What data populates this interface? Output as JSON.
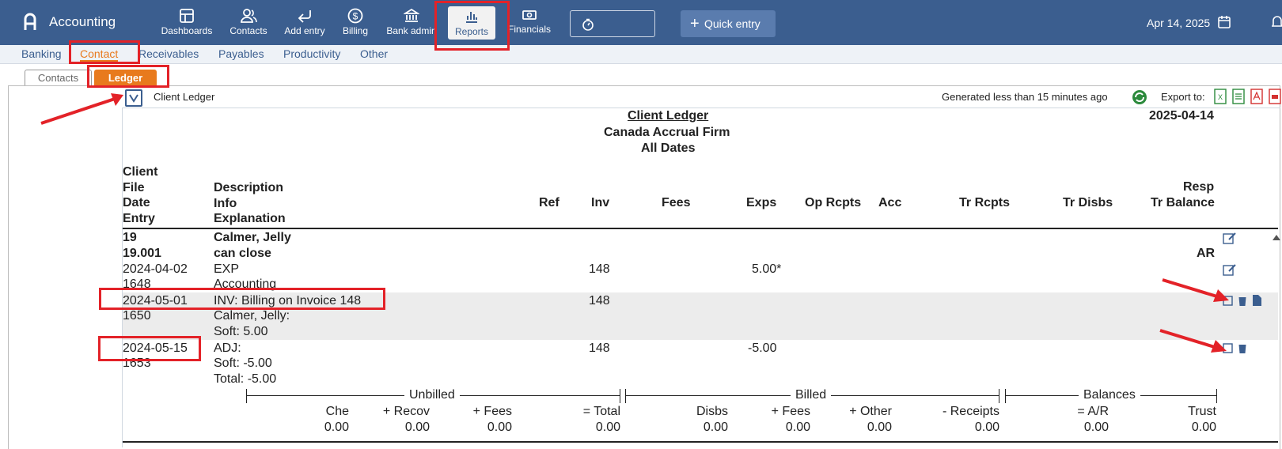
{
  "app": {
    "title": "Accounting"
  },
  "nav": [
    {
      "label": "Dashboards"
    },
    {
      "label": "Contacts"
    },
    {
      "label": "Add entry"
    },
    {
      "label": "Billing"
    },
    {
      "label": "Bank admin"
    },
    {
      "label": "Reports"
    },
    {
      "label": "Financials"
    }
  ],
  "quick_entry": "Quick entry",
  "date": "Apr 14, 2025",
  "subnav": [
    "Banking",
    "Contact",
    "Receivables",
    "Payables",
    "Productivity",
    "Other"
  ],
  "tabs": [
    "Contacts",
    "Ledger"
  ],
  "report_bar": {
    "name": "Client Ledger",
    "generated": "Generated less than 15 minutes ago",
    "export_label": "Export to:"
  },
  "report": {
    "title": "Client Ledger",
    "firm": "Canada Accrual Firm",
    "range": "All Dates",
    "date": "2025-04-14",
    "headers": {
      "client": "Client",
      "file": "File",
      "date": "Date",
      "entry": "Entry",
      "description": "Description",
      "info": "Info",
      "explanation": "Explanation",
      "ref": "Ref",
      "inv": "Inv",
      "fees": "Fees",
      "exps": "Exps",
      "op_rcpts": "Op Rcpts",
      "acc": "Acc",
      "tr_rcpts": "Tr Rcpts",
      "tr_disbs": "Tr Disbs",
      "resp": "Resp",
      "tr_balance": "Tr Balance"
    },
    "client_no": "19",
    "client_name": "Calmer, Jelly",
    "file_no": "19.001",
    "file_desc": "can close",
    "resp": "AR",
    "rows": [
      {
        "date": "2024-04-02",
        "entry": "1648",
        "desc": "EXP",
        "info": "Accounting",
        "inv": "148",
        "exps": "5.00*"
      },
      {
        "date": "2024-05-01",
        "entry": "1650",
        "desc": "INV: Billing on Invoice 148",
        "info": "Calmer, Jelly:",
        "expl": "Soft: 5.00",
        "inv": "148"
      },
      {
        "date": "2024-05-15",
        "entry": "1653",
        "desc": "ADJ:",
        "info": "Soft: -5.00",
        "expl": "Total: -5.00",
        "inv": "148",
        "exps": "-5.00"
      }
    ],
    "summary": {
      "groups": [
        "Unbilled",
        "Billed",
        "Balances"
      ],
      "cols": [
        {
          "label": "Che",
          "value": "0.00"
        },
        {
          "label": "+ Recov",
          "value": "0.00"
        },
        {
          "label": "+ Fees",
          "value": "0.00"
        },
        {
          "label": "= Total",
          "value": "0.00"
        },
        {
          "label": "Disbs",
          "value": "0.00"
        },
        {
          "label": "+ Fees",
          "value": "0.00"
        },
        {
          "label": "+ Other",
          "value": "0.00"
        },
        {
          "label": "- Receipts",
          "value": "0.00"
        },
        {
          "label": "= A/R",
          "value": "0.00"
        },
        {
          "label": "Trust",
          "value": "0.00"
        }
      ]
    }
  }
}
